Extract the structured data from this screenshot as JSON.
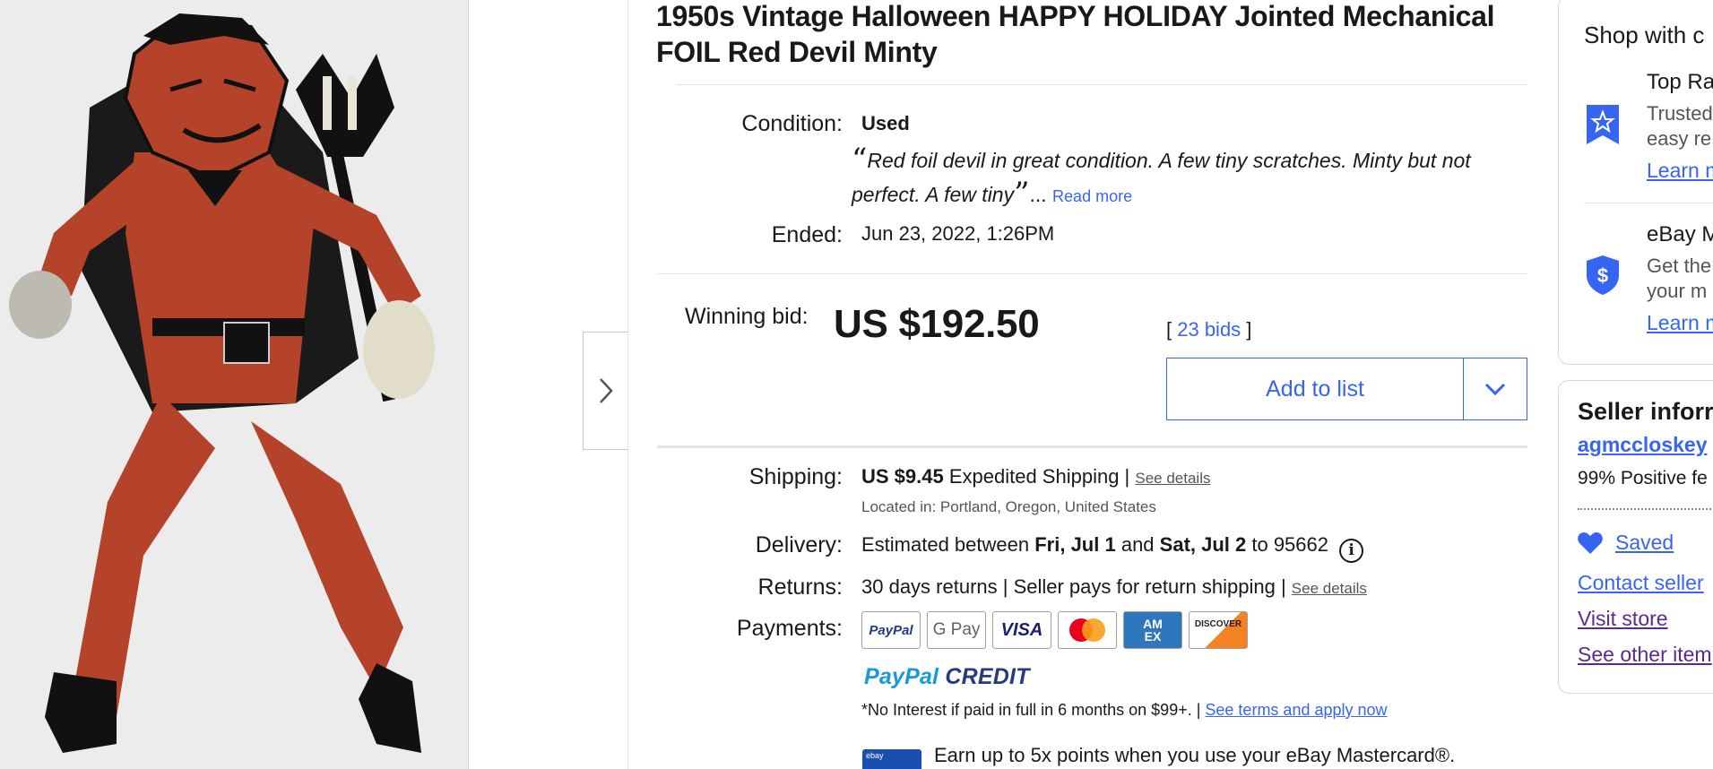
{
  "listing": {
    "title": "1950s Vintage Halloween HAPPY HOLIDAY Jointed Mechanical FOIL Red Devil Minty"
  },
  "condition": {
    "label": "Condition:",
    "value": "Used",
    "quote": "Red foil devil in great condition. A few tiny scratches. Minty but not perfect. A few tiny",
    "ellipsis": "...",
    "read_more": "Read more"
  },
  "ended": {
    "label": "Ended:",
    "value": "Jun 23, 2022, 1:26PM"
  },
  "bid": {
    "label": "Winning bid:",
    "price": "US $192.50",
    "bids_open": "[ ",
    "bids_link": "23 bids",
    "bids_close": " ]",
    "add_to_list": "Add to list"
  },
  "shipping": {
    "label": "Shipping:",
    "price": "US $9.45",
    "method": " Expedited Shipping | ",
    "see_details": "See details",
    "location": "Located in: Portland, Oregon, United States"
  },
  "delivery": {
    "label": "Delivery:",
    "pre": "Estimated between ",
    "start": "Fri, Jul 1",
    "mid": " and ",
    "end": "Sat, Jul 2",
    "post": " to 95662",
    "info_glyph": "i"
  },
  "returns": {
    "label": "Returns:",
    "text": "30 days returns | Seller pays for return shipping | ",
    "see_details": "See details"
  },
  "payments": {
    "label": "Payments:",
    "methods": [
      "PayPal",
      "G Pay",
      "VISA",
      "Mastercard",
      "AM EX",
      "DISCOVER"
    ],
    "paypal_credit_a": "PayPal",
    "paypal_credit_b": " CREDIT",
    "terms": "*No Interest if paid in full in 6 months on $99+. | ",
    "terms_link": "See terms and apply now",
    "mastercard_promo": "Earn up to 5x points when you use your eBay Mastercard®.",
    "mastercard_card_text": "ebay"
  },
  "sidebar": {
    "shop_with": "Shop with c",
    "top_rated_title": "Top Ra",
    "top_rated_line1": "Trusted",
    "top_rated_line2": "easy re",
    "learn_more_1": "Learn m",
    "money_back_title": "eBay M",
    "money_back_line1": "Get the",
    "money_back_line2": "your m",
    "learn_more_2": "Learn m",
    "seller_info": "Seller inforr",
    "seller_name": "agmccloskey",
    "feedback": "99% Positive fe",
    "saved": "Saved",
    "contact": "Contact seller",
    "visit_store": "Visit store",
    "see_other": "See other item"
  },
  "colors": {
    "accent": "#3665f3",
    "text": "#191919",
    "purple_link": "#5b2b8c",
    "devil_red": "#b5432a"
  },
  "icons": [
    "chevron-right-icon",
    "chevron-down-icon",
    "info-icon",
    "star-badge-icon",
    "dollar-shield-icon",
    "heart-icon"
  ]
}
